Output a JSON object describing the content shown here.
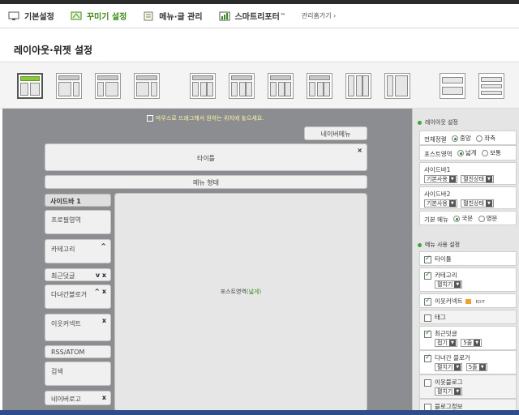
{
  "nav": {
    "items": [
      {
        "label": "기본설정",
        "icon": "monitor-icon",
        "active": false
      },
      {
        "label": "꾸미기 설정",
        "icon": "paint-icon",
        "active": true
      },
      {
        "label": "메뉴·글 관리",
        "icon": "notepad-icon",
        "active": false
      },
      {
        "label": "스마트리포터",
        "icon": "chart-icon",
        "active": false,
        "suffix": "™"
      }
    ],
    "admin_link": "관리홈가기 ›"
  },
  "page": {
    "title": "레이아웃·위젯 설정"
  },
  "layouts": {
    "selected_index": 0,
    "count": 12
  },
  "canvas": {
    "hint": "마우스로 드래그해서 원하는 위치에 놓으세요.",
    "naver_menu": "네이버메뉴",
    "title_widget": "타이틀",
    "menu_bar": "메뉴 형태",
    "sidebar_head": "사이드바 1",
    "sidebar_widgets": [
      {
        "label": "프로필영역",
        "ctrl": ""
      },
      {
        "label": "카테고리",
        "ctrl": "^"
      },
      {
        "label": "최근덧글",
        "ctrl": "v x"
      },
      {
        "label": "다녀간블로거",
        "ctrl": "^ x"
      },
      {
        "label": "이웃커넥트",
        "ctrl": "x"
      },
      {
        "label": "RSS/ATOM",
        "ctrl": ""
      },
      {
        "label": "검색",
        "ctrl": ""
      },
      {
        "label": "네이버로고",
        "ctrl": "x"
      }
    ],
    "post_area_label": "포스트영역",
    "post_area_suffix": "(넓게)",
    "close_symbol": "×"
  },
  "panel": {
    "layout_settings": {
      "title": "레이아웃 설정",
      "align_label": "전체정렬",
      "align_options": [
        "중앙",
        "좌측"
      ],
      "align_selected": "중앙",
      "post_label": "포스트영역",
      "post_options": [
        "넓게",
        "보통"
      ],
      "post_selected": "넓게",
      "sidebar1_label": "사이드바1",
      "sidebar1_values": [
        "기본사용",
        "펼친상태"
      ],
      "sidebar2_label": "사이드바2",
      "sidebar2_values": [
        "기본사용",
        "펼친상태"
      ],
      "basic_menu_label": "기본 메뉴",
      "basic_menu_options": [
        "국문",
        "영문"
      ],
      "basic_menu_selected": "국문"
    },
    "menu_settings": {
      "title": "메뉴 사용 설정",
      "items": [
        {
          "label": "타이틀",
          "checked": true
        },
        {
          "label": "카테고리",
          "checked": true,
          "select": "펼치기"
        },
        {
          "label": "이웃커넥트",
          "checked": true,
          "edit": "EDIT"
        },
        {
          "label": "태그",
          "checked": false
        },
        {
          "label": "최근덧글",
          "checked": true,
          "select": "접기",
          "select2": "5줄"
        },
        {
          "label": "다녀간 블로거",
          "checked": true,
          "select": "펼치기",
          "select2": "5줄"
        },
        {
          "label": "이웃블로그",
          "checked": false,
          "select": "펼치기"
        },
        {
          "label": "블로그정보",
          "checked": false
        }
      ]
    }
  }
}
